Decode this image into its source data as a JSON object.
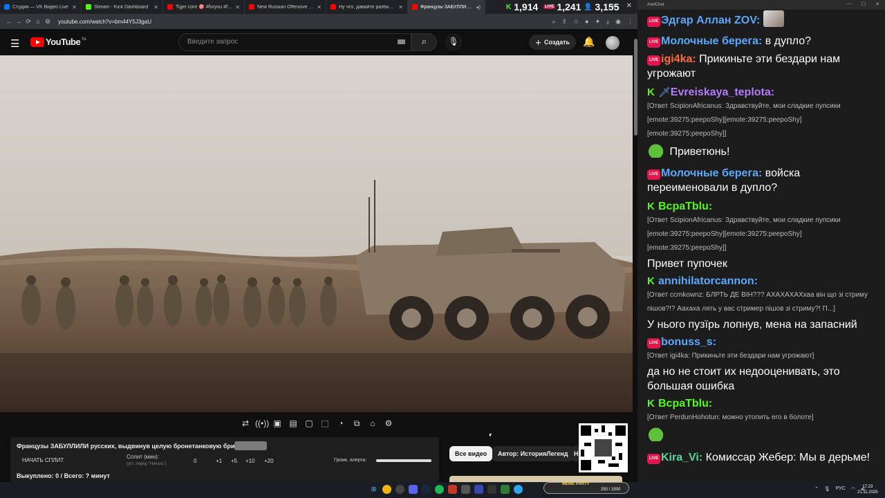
{
  "browser": {
    "tabs": [
      {
        "label": "Студия — VK Видео Live",
        "color": "#0077ff"
      },
      {
        "label": "Stream - Kick Dashboard",
        "color": "#53fc18"
      },
      {
        "label": "Tiger core 🎯 #foryou #funny #",
        "color": "#ff0000"
      },
      {
        "label": "New Russian Offensive STEAMR",
        "color": "#ff0000"
      },
      {
        "label": "Ну что, давайте разбираться",
        "color": "#ff0000"
      },
      {
        "label": "Французы ЗАБУЛЛИЛИ ру",
        "color": "#ff0000",
        "active": true
      }
    ],
    "stats": {
      "kick": "1,914",
      "vk": "1,241",
      "viewers": "3,155"
    },
    "url": "youtube.com/watch?v=bm44Y5J3gaU"
  },
  "youtube": {
    "logo": "YouTube",
    "country": "NL",
    "search_placeholder": "Введите запрос",
    "create_label": "Создать"
  },
  "panel": {
    "title": "Французы ЗАБУЛЛИЛИ русских, выдвинув целую бронетанковую бригаду",
    "badge": "",
    "start_split": "НАЧАТЬ СПЛИТ",
    "split_label": "Сплит (мин):",
    "split_sub": "(уст. перед \"Начать\")",
    "split_values": [
      "0",
      "+1",
      "+5",
      "+10",
      "+20"
    ],
    "alert_label": "Громк. алерта:",
    "alert_volume": 1.0,
    "bought": "Выкуплено: 0 / Всего: ? минут"
  },
  "chips": {
    "all": "Все видео",
    "author": "Автор: ИсторияЛегенд",
    "more": "Н"
  },
  "chat": {
    "title": "AxelChat",
    "messages": [
      {
        "platform": "vk",
        "nick": "Эдгар Аллан ZOV:",
        "color": "#5aa9ff",
        "text": ""
      },
      {
        "platform": "vk",
        "nick": "Молочные берега:",
        "color": "#5aa9ff",
        "text": " в дупло?"
      },
      {
        "platform": "vk",
        "nick": "igi4ka:",
        "color": "#ff6e3a",
        "text": " Прикиньте эти бездари нам угрожают"
      },
      {
        "platform": "kick",
        "nick": "Evreiskaya_teplota:",
        "color": "#b57bff",
        "reply": "[Ответ ScipionAfricanus: Здравствуйте, мои сладкие пупсики [emote:39275:peepoShy][emote:39275:peepoShy] [emote:39275:peepoShy]]",
        "text": "Приветюнь!"
      },
      {
        "platform": "vk",
        "nick": "Молочные берега:",
        "color": "#5aa9ff",
        "text": " войска переименовали в дупло?"
      },
      {
        "platform": "kick",
        "nick": "ВсраТblu:",
        "color": "#53fc18",
        "reply": "[Ответ ScipionAfricanus: Здравствуйте, мои сладкие пупсики [emote:39275:peepoShy][emote:39275:peepoShy] [emote:39275:peepoShy]]",
        "text": "Привет пупочек"
      },
      {
        "platform": "kick",
        "nick": "annihilatorcannon:",
        "color": "#5aa9ff",
        "reply": "[Ответ ccmkownz: БЛРТЬ ДЕ ВІН??? АХАХАХАХхаа він що зі стриму пішов?!? Аахаха лять у вас стример пішов зі стриму?! П...]",
        "text": "У нього пузїрь лопнув, мена на запасний"
      },
      {
        "platform": "vk",
        "nick": "bonuss_s:",
        "color": "#5aa9ff",
        "reply": "[Ответ igi4ka: Прикиньте эти бездари нам угрожают]",
        "text": "да но не стоит их недооценивать, это большая ошибка"
      },
      {
        "platform": "kick",
        "nick": "ВсраТblu:",
        "color": "#53fc18",
        "reply": "[Ответ PerdunHohotun: можно утопить его в болоте]",
        "text": ""
      },
      {
        "platform": "vk",
        "nick": "Kira_Vi:",
        "color": "#5cd6a0",
        "text": " Комиссар Жебер: Мы в дерьме!"
      }
    ]
  },
  "taskbar": {
    "meme": "MEME PARTY",
    "meme_progress": "250 / 1500",
    "lang": "РУС",
    "time": "17:23",
    "date": "21.11.2025"
  },
  "icons": [
    "hamburger-icon",
    "search-icon",
    "mic-icon",
    "bell-icon",
    "loop-icon",
    "broadcast-icon",
    "screen-icon",
    "clapper-icon",
    "frame-icon",
    "fullscreen-icon",
    "speed-icon",
    "pip-icon",
    "camera-icon",
    "gear-icon"
  ]
}
